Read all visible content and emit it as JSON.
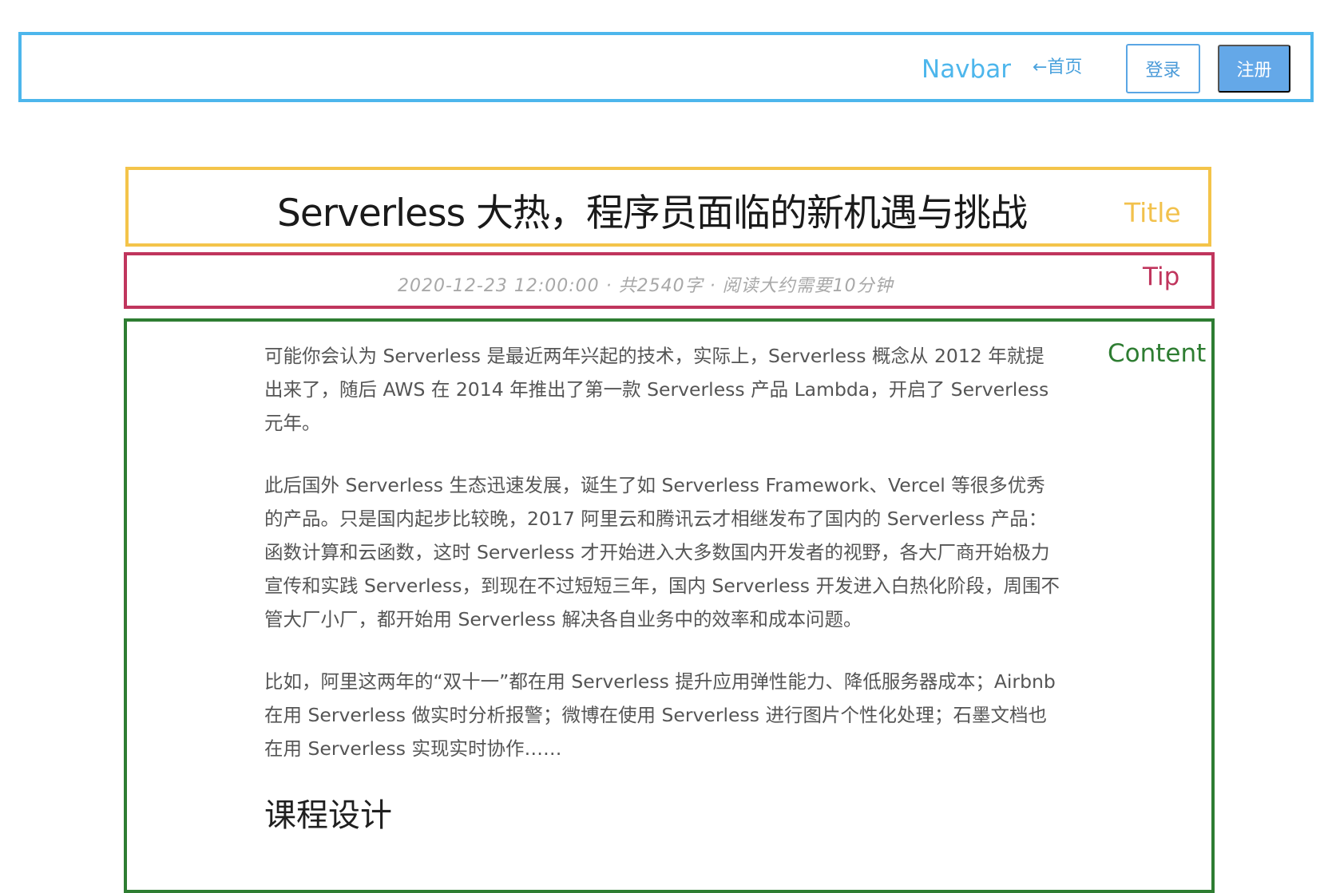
{
  "navbar": {
    "tag": "Navbar",
    "home_link": "←首页",
    "login_label": "登录",
    "register_label": "注册"
  },
  "title": {
    "text": "Serverless 大热，程序员面临的新机遇与挑战",
    "tag": "Title"
  },
  "tip": {
    "text": "2020-12-23 12:00:00 · 共2540字 · 阅读大约需要10分钟",
    "tag": "Tip"
  },
  "content": {
    "tag": "Content",
    "paragraphs": [
      "可能你会认为 Serverless 是最近两年兴起的技术，实际上，Serverless 概念从 2012 年就提出来了，随后 AWS 在 2014 年推出了第一款 Serverless 产品 Lambda，开启了 Serverless 元年。",
      "此后国外 Serverless 生态迅速发展，诞生了如 Serverless Framework、Vercel 等很多优秀的产品。只是国内起步比较晚，2017 阿里云和腾讯云才相继发布了国内的 Serverless 产品：函数计算和云函数，这时 Serverless 才开始进入大多数国内开发者的视野，各大厂商开始极力宣传和实践 Serverless，到现在不过短短三年，国内 Serverless 开发进入白热化阶段，周围不管大厂小厂，都开始用 Serverless 解决各自业务中的效率和成本问题。",
      "比如，阿里这两年的“双十一”都在用 Serverless 提升应用弹性能力、降低服务器成本；Airbnb 在用 Serverless 做实时分析报警；微博在使用 Serverless 进行图片个性化处理；石墨文档也在用 Serverless 实现实时协作……"
    ],
    "heading": "课程设计"
  },
  "colors": {
    "navbar_border": "#4db6ec",
    "title_border": "#f4c44a",
    "tip_border": "#c0355d",
    "content_border": "#2e7d32",
    "primary_button": "#64a8e8"
  }
}
